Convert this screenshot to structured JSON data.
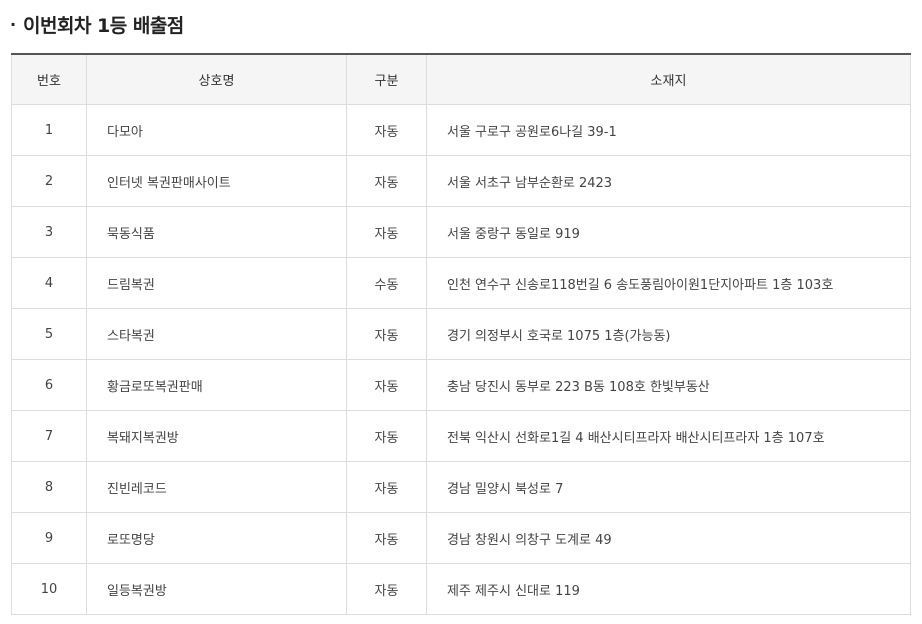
{
  "section": {
    "bullet": "·",
    "title": "이번회차 1등 배출점"
  },
  "table": {
    "headers": {
      "num": "번호",
      "name": "상호명",
      "type": "구분",
      "addr": "소재지"
    },
    "rows": [
      {
        "num": "1",
        "name": "다모아",
        "type": "자동",
        "addr": "서울 구로구 공원로6나길 39-1"
      },
      {
        "num": "2",
        "name": "인터넷 복권판매사이트",
        "type": "자동",
        "addr": "서울 서초구 남부순환로 2423"
      },
      {
        "num": "3",
        "name": "묵동식품",
        "type": "자동",
        "addr": "서울 중랑구 동일로 919"
      },
      {
        "num": "4",
        "name": "드림복권",
        "type": "수동",
        "addr": "인천 연수구 신송로118번길 6 송도풍림아이원1단지아파트 1층 103호"
      },
      {
        "num": "5",
        "name": "스타복권",
        "type": "자동",
        "addr": "경기 의정부시 호국로 1075 1층(가능동)"
      },
      {
        "num": "6",
        "name": "황금로또복권판매",
        "type": "자동",
        "addr": "충남 당진시 동부로 223 B동 108호 한빛부동산"
      },
      {
        "num": "7",
        "name": "복돼지복권방",
        "type": "자동",
        "addr": "전북 익산시 선화로1길 4 배산시티프라자 배산시티프라자 1층 107호"
      },
      {
        "num": "8",
        "name": "진빈레코드",
        "type": "자동",
        "addr": "경남 밀양시 북성로 7"
      },
      {
        "num": "9",
        "name": "로또명당",
        "type": "자동",
        "addr": "경남 창원시 의창구 도계로 49"
      },
      {
        "num": "10",
        "name": "일등복권방",
        "type": "자동",
        "addr": "제주 제주시 신대로 119"
      }
    ]
  }
}
